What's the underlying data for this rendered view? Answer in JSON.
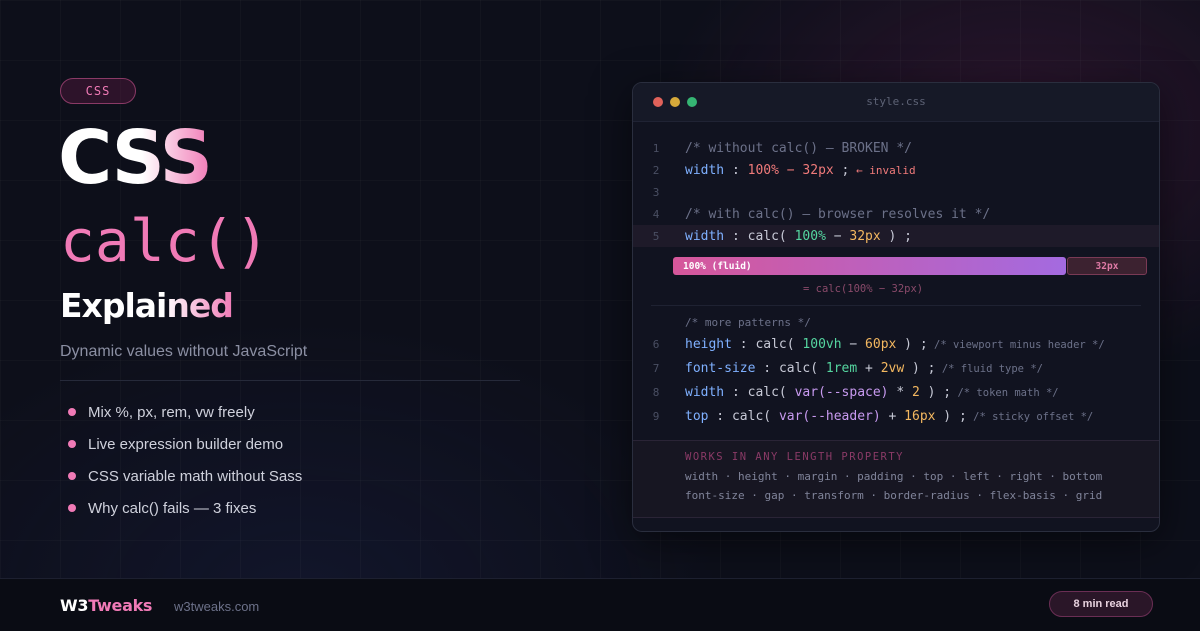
{
  "hero": {
    "tag": "CSS",
    "title_line1": "CSS",
    "title_line2": "calc()",
    "title_line3": "Explained",
    "subtitle": "Dynamic values without JavaScript",
    "bullets": [
      "Mix %, px, rem, vw freely",
      "Live expression builder demo",
      "CSS variable math without Sass",
      "Why calc() fails — 3 fixes"
    ]
  },
  "editor": {
    "filename": "style.css",
    "line_numbers": [
      "1",
      "2",
      "3",
      "4",
      "5",
      "6",
      "7",
      "8",
      "9"
    ],
    "line1": {
      "comment": "/* without calc() — BROKEN */"
    },
    "line2": {
      "prop": "width",
      "colon": " : ",
      "value": "100% − 32px",
      "semi": " ;",
      "note": " ← invalid"
    },
    "line4": {
      "comment": "/* with calc() — browser resolves it */"
    },
    "line5": {
      "prop": "width",
      "colon": " : ",
      "fn_open": "calc( ",
      "num": "100%",
      "op": " − ",
      "unit": "32px",
      "close": " ) ;"
    },
    "demo": {
      "fluid_label": "100% (fluid)",
      "fixed_label": "32px",
      "fluid_fraction": 0.83,
      "formula": "= calc(100% − 32px)"
    },
    "patterns_comment": "/* more patterns */",
    "line6": {
      "prop": "height",
      "colon": " : ",
      "fn_open": "calc( ",
      "a": "100vh",
      "op": " − ",
      "b": "60px",
      "close": " ) ;",
      "comment": " /* viewport minus header */"
    },
    "line7": {
      "prop": "font-size",
      "colon": " : ",
      "fn_open": "calc( ",
      "a": "1rem",
      "op": " + ",
      "b": "2vw",
      "close": " ) ;",
      "comment": " /* fluid type */"
    },
    "line8": {
      "prop": "width",
      "colon": " : ",
      "fn_open": "calc( ",
      "a": "var(--space)",
      "op": " * ",
      "b": "2",
      "close": " ) ;",
      "comment": " /* token math */"
    },
    "line9": {
      "prop": "top",
      "colon": " : ",
      "fn_open": "calc( ",
      "a": "var(--header)",
      "op": " + ",
      "b": "16px",
      "close": " ) ;",
      "comment": " /* sticky offset */"
    },
    "footer": {
      "heading": "WORKS IN ANY LENGTH PROPERTY",
      "list1": "width · height · margin · padding · top · left · right · bottom",
      "list2": "font-size · gap · transform · border-radius · flex-basis · grid"
    }
  },
  "bottom": {
    "logo_w3": "W3",
    "logo_tweaks": "Tweaks",
    "site": "w3tweaks.com",
    "read_time": "8 min read"
  },
  "colors": {
    "background": "#0d0f1a",
    "accent_pink": "#f07ab6",
    "purple": "#a46ae0",
    "green": "#55d6a0",
    "orange": "#f4b860",
    "blue": "#7fb0ff",
    "red": "#f07a7a"
  }
}
